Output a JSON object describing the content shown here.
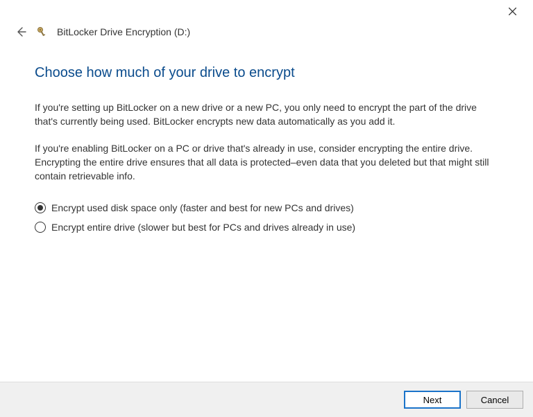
{
  "window": {
    "title": "BitLocker Drive Encryption (D:)"
  },
  "page": {
    "heading": "Choose how much of your drive to encrypt",
    "paragraph1": "If you're setting up BitLocker on a new drive or a new PC, you only need to encrypt the part of the drive that's currently being used. BitLocker encrypts new data automatically as you add it.",
    "paragraph2": "If you're enabling BitLocker on a PC or drive that's already in use, consider encrypting the entire drive. Encrypting the entire drive ensures that all data is protected–even data that you deleted but that might still contain retrievable info."
  },
  "options": {
    "option1_label": "Encrypt used disk space only (faster and best for new PCs and drives)",
    "option2_label": "Encrypt entire drive (slower but best for PCs and drives already in use)",
    "selected": "option1"
  },
  "footer": {
    "next_label": "Next",
    "cancel_label": "Cancel"
  }
}
